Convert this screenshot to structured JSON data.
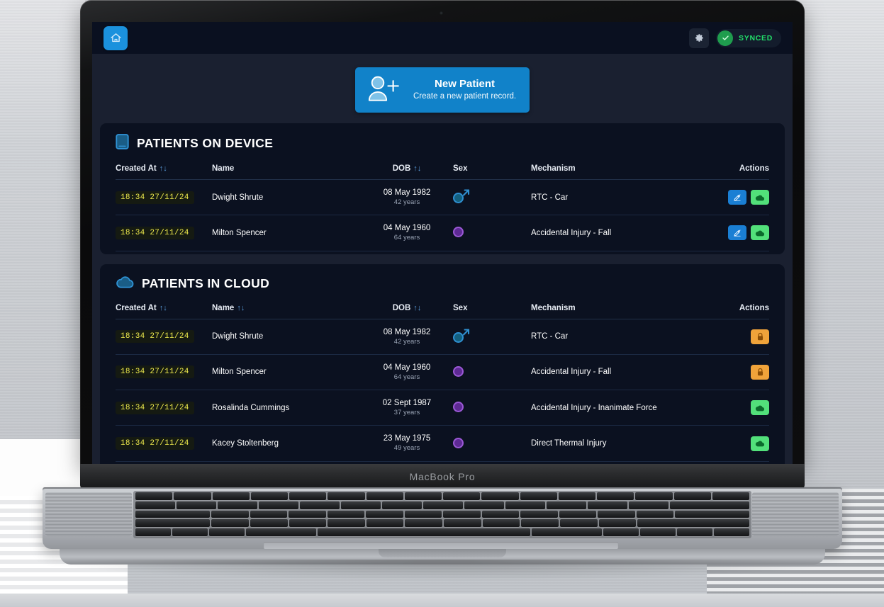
{
  "device": {
    "model_label": "MacBook Pro"
  },
  "topbar": {
    "home_icon": "home-icon",
    "gear_icon": "gear-icon",
    "sync_status": "SYNCED",
    "sync_icon": "check-circle-icon"
  },
  "hero": {
    "icon": "user-plus-icon",
    "title": "New Patient",
    "subtitle": "Create a new patient record."
  },
  "sections": [
    {
      "id": "patients-on-device",
      "icon": "device-icon",
      "title": "PATIENTS ON DEVICE",
      "columns": [
        {
          "label": "Created At",
          "sortable": true,
          "sort_glyph": "↑↓"
        },
        {
          "label": "Name",
          "sortable": false,
          "sort_glyph": ""
        },
        {
          "label": "DOB",
          "sortable": true,
          "sort_glyph": "↑↓"
        },
        {
          "label": "Sex",
          "sortable": false,
          "sort_glyph": ""
        },
        {
          "label": "Mechanism",
          "sortable": false,
          "sort_glyph": ""
        },
        {
          "label": "Actions",
          "sortable": false,
          "sort_glyph": ""
        }
      ],
      "rows": [
        {
          "created_at": "18:34  27/11/24",
          "name": "Dwight Shrute",
          "dob_date": "08 May 1982",
          "dob_age": "42 years",
          "sex": "male",
          "mechanism": "RTC - Car",
          "actions": [
            "edit",
            "cloud-upload"
          ]
        },
        {
          "created_at": "18:34  27/11/24",
          "name": "Milton Spencer",
          "dob_date": "04 May 1960",
          "dob_age": "64 years",
          "sex": "female",
          "mechanism": "Accidental Injury - Fall",
          "actions": [
            "edit",
            "cloud-upload"
          ]
        }
      ]
    },
    {
      "id": "patients-in-cloud",
      "icon": "cloud-icon",
      "title": "PATIENTS IN CLOUD",
      "columns": [
        {
          "label": "Created At",
          "sortable": true,
          "sort_glyph": "↑↓"
        },
        {
          "label": "Name",
          "sortable": true,
          "sort_glyph": "↑↓"
        },
        {
          "label": "DOB",
          "sortable": true,
          "sort_glyph": "↑↓"
        },
        {
          "label": "Sex",
          "sortable": false,
          "sort_glyph": ""
        },
        {
          "label": "Mechanism",
          "sortable": false,
          "sort_glyph": ""
        },
        {
          "label": "Actions",
          "sortable": false,
          "sort_glyph": ""
        }
      ],
      "rows": [
        {
          "created_at": "18:34  27/11/24",
          "name": "Dwight Shrute",
          "dob_date": "08 May 1982",
          "dob_age": "42 years",
          "sex": "male",
          "mechanism": "RTC - Car",
          "actions": [
            "lock"
          ]
        },
        {
          "created_at": "18:34  27/11/24",
          "name": "Milton Spencer",
          "dob_date": "04 May 1960",
          "dob_age": "64 years",
          "sex": "female",
          "mechanism": "Accidental Injury - Fall",
          "actions": [
            "lock"
          ]
        },
        {
          "created_at": "18:34  27/11/24",
          "name": "Rosalinda Cummings",
          "dob_date": "02 Sept 1987",
          "dob_age": "37 years",
          "sex": "female",
          "mechanism": "Accidental Injury - Inanimate Force",
          "actions": [
            "cloud-download"
          ]
        },
        {
          "created_at": "18:34  27/11/24",
          "name": "Kacey Stoltenberg",
          "dob_date": "23 May 1975",
          "dob_age": "49 years",
          "sex": "female",
          "mechanism": "Direct Thermal Injury",
          "actions": [
            "cloud-download"
          ]
        },
        {
          "created_at": "",
          "name": "",
          "dob_date": "",
          "dob_age": "",
          "sex": "",
          "mechanism": "",
          "actions": [
            "cloud-download"
          ]
        }
      ]
    }
  ],
  "colors": {
    "accent_blue": "#1182c9",
    "page_bg": "#1a2030",
    "card_bg": "#0b1120",
    "topbar_bg": "#0a1020",
    "sync_green": "#22e06a",
    "timestamp_yellow": "#eeea4d",
    "action_green": "#52e07a",
    "action_orange": "#f0a33a",
    "sex_male": "#2f8fd0",
    "sex_female": "#9b59d6"
  }
}
